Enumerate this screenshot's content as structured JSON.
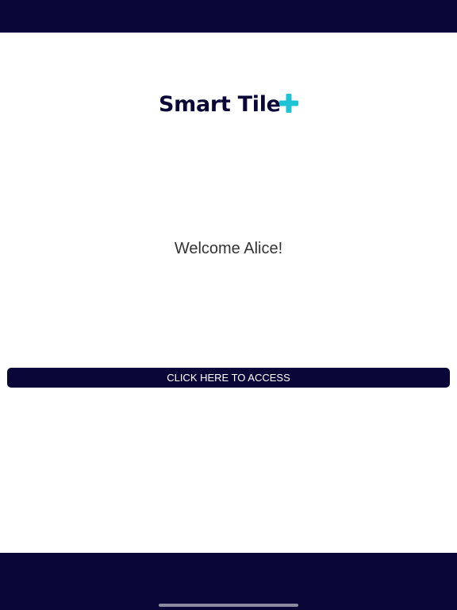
{
  "app": {
    "brand_name": "Smart Tile",
    "brand_icon": "plus-icon",
    "colors": {
      "navy": "#0b0638",
      "accent": "#1ec3d6",
      "background": "#ffffff",
      "text": "#333333"
    }
  },
  "main": {
    "welcome_text": "Welcome Alice!",
    "access_button_label": "CLICK HERE TO ACCESS"
  }
}
